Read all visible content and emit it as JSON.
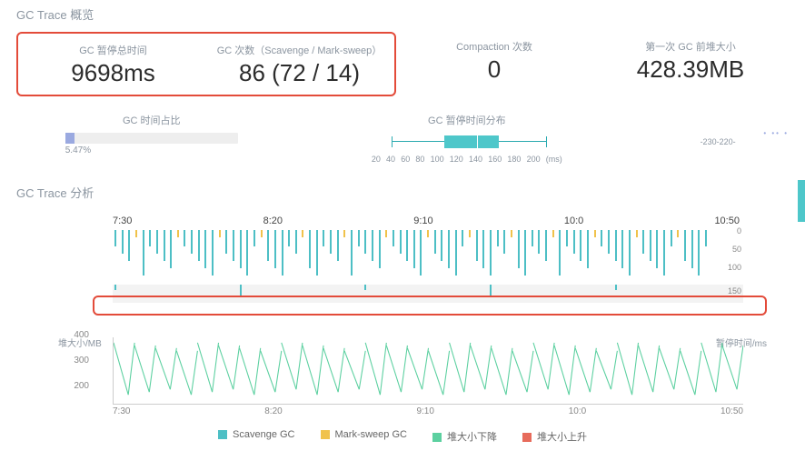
{
  "sections": {
    "overview_title": "GC Trace 概览",
    "analysis_title": "GC Trace 分析"
  },
  "kpis": {
    "pause_total": {
      "label": "GC 暂停总时间",
      "value": "9698ms"
    },
    "gc_count": {
      "label": "GC 次数（Scavenge / Mark-sweep）",
      "value": "86 (72 / 14)"
    },
    "compaction": {
      "label": "Compaction 次数",
      "value": "0"
    },
    "first_heap": {
      "label": "第一次 GC 前堆大小",
      "value": "428.39MB"
    }
  },
  "distributions": {
    "time_ratio": {
      "label": "GC 时间占比",
      "value_pct": "5.47%"
    },
    "pause_dist": {
      "label": "GC 暂停时间分布",
      "unit_label": "(ms)",
      "ticks": [
        "20",
        "40",
        "60",
        "80",
        "100",
        "120",
        "140",
        "160",
        "180",
        "200"
      ]
    },
    "heap_before_dist": {
      "range_label": "-230-220-"
    }
  },
  "timeline": {
    "yaxis_right_label": "暂停时间/ms",
    "yaxis_left_label": "堆大小/MB",
    "top_ticks": [
      "7:30",
      "8:20",
      "9:10",
      "10:0",
      "10:50"
    ],
    "bottom_ticks": [
      "7:30",
      "8:20",
      "9:10",
      "10:0",
      "10:50"
    ],
    "pause_yticks": [
      "0",
      "50",
      "100",
      "150"
    ],
    "heap_yticks": [
      "400",
      "300",
      "200"
    ]
  },
  "legend": {
    "scavenge": "Scavenge GC",
    "marksweep": "Mark-sweep GC",
    "heap_down": "堆大小下降",
    "heap_up": "堆大小上升"
  },
  "chart_data": {
    "charts": [
      {
        "type": "progress",
        "title": "GC 时间占比",
        "value_pct": 5.47
      },
      {
        "type": "boxplot",
        "title": "GC 暂停时间分布",
        "unit": "ms",
        "min": 40,
        "q1": 90,
        "median": 120,
        "q3": 140,
        "max": 200,
        "axis_range": [
          20,
          200
        ]
      },
      {
        "type": "timeline-bar",
        "title": "GC 暂停时间",
        "x_range": [
          "07:30",
          "10:50"
        ],
        "y_range_ms": [
          0,
          150
        ],
        "series": [
          {
            "name": "Scavenge GC",
            "count": 72,
            "typical_pause_ms": 50
          },
          {
            "name": "Mark-sweep GC",
            "count": 14,
            "typical_pause_ms": 120
          }
        ]
      },
      {
        "type": "line",
        "title": "堆大小",
        "x_range": [
          "07:30",
          "10:50"
        ],
        "y_range_mb": [
          200,
          430
        ],
        "pattern": "sawtooth between ~240MB and ~430MB, ~30 cycles",
        "series": [
          {
            "name": "堆大小下降",
            "color": "#5cd0a0"
          },
          {
            "name": "堆大小上升",
            "color": "#e76b5b"
          }
        ]
      }
    ]
  }
}
